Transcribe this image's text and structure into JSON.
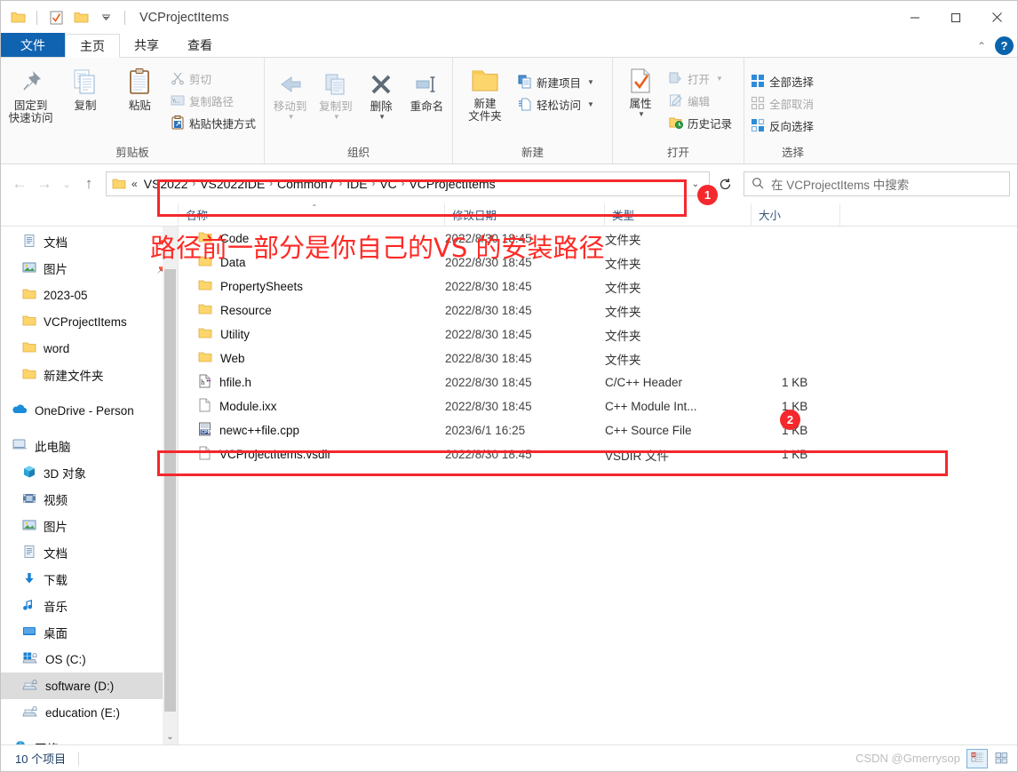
{
  "window": {
    "title": "VCProjectItems",
    "minimize_label": "—",
    "maximize_label": "□",
    "close_label": "✕"
  },
  "quick_access": {
    "folder_icon": "folder-icon",
    "properties_icon": "checkbox-properties-icon",
    "new_folder_icon": "new-folder-icon",
    "dropdown_icon": "chevron-down-icon"
  },
  "tabs": [
    {
      "label": "文件",
      "name": "tab-file"
    },
    {
      "label": "主页",
      "name": "tab-home"
    },
    {
      "label": "共享",
      "name": "tab-share"
    },
    {
      "label": "查看",
      "name": "tab-view"
    }
  ],
  "ribbon": {
    "collapse_icon": "chevron-up-icon",
    "help_label": "?",
    "groups": [
      {
        "label": "剪贴板",
        "big": [
          {
            "label": "固定到\n快速访问",
            "line1": "固定到",
            "line2": "快速访问",
            "icon": "pin-icon"
          },
          {
            "label": "复制",
            "icon": "copy-icon"
          },
          {
            "label": "粘贴",
            "icon": "paste-icon"
          }
        ],
        "small": [
          {
            "label": "剪切",
            "icon": "scissors-icon",
            "disabled": true
          },
          {
            "label": "复制路径",
            "icon": "copy-path-icon",
            "disabled": true
          },
          {
            "label": "粘贴快捷方式",
            "icon": "paste-shortcut-icon",
            "disabled": false
          }
        ]
      },
      {
        "label": "组织",
        "big": [
          {
            "label": "移动到",
            "icon": "move-to-icon",
            "caret": true,
            "disabled": true
          },
          {
            "label": "复制到",
            "icon": "copy-to-icon",
            "caret": true,
            "disabled": true
          },
          {
            "label": "删除",
            "icon": "delete-x-icon",
            "caret": true
          },
          {
            "label": "重命名",
            "icon": "rename-icon"
          }
        ]
      },
      {
        "label": "新建",
        "big": [
          {
            "line1": "新建",
            "line2": "文件夹",
            "icon": "new-folder-icon"
          }
        ],
        "small": [
          {
            "label": "新建项目",
            "icon": "new-item-icon",
            "caret": true
          },
          {
            "label": "轻松访问",
            "icon": "easy-access-icon",
            "caret": true
          }
        ]
      },
      {
        "label": "打开",
        "big": [
          {
            "label": "属性",
            "icon": "properties-icon",
            "caret": true
          }
        ],
        "small": [
          {
            "label": "打开",
            "icon": "open-icon",
            "caret": true,
            "disabled": true
          },
          {
            "label": "编辑",
            "icon": "edit-icon",
            "disabled": true
          },
          {
            "label": "历史记录",
            "icon": "history-icon"
          }
        ]
      },
      {
        "label": "选择",
        "small": [
          {
            "label": "全部选择",
            "icon": "select-all-icon"
          },
          {
            "label": "全部取消",
            "icon": "select-none-icon",
            "disabled": true
          },
          {
            "label": "反向选择",
            "icon": "invert-selection-icon"
          }
        ]
      }
    ]
  },
  "address": {
    "back_icon": "arrow-left-icon",
    "forward_icon": "arrow-right-icon",
    "recent_icon": "chevron-down-icon",
    "up_icon": "arrow-up-icon",
    "folder_icon": "folder-icon",
    "overflow": "«",
    "crumbs": [
      "VS2022",
      "VS2022IDE",
      "Common7",
      "IDE",
      "VC",
      "VCProjectItems"
    ],
    "separator": "›",
    "dropdown_icon": "chevron-down-icon",
    "refresh_icon": "refresh-icon",
    "search_icon": "search-icon",
    "search_placeholder": "在 VCProjectItems 中搜索"
  },
  "columns": [
    {
      "label": "名称",
      "name": "column-name"
    },
    {
      "label": "修改日期",
      "name": "column-date"
    },
    {
      "label": "类型",
      "name": "column-type"
    },
    {
      "label": "大小",
      "name": "column-size"
    }
  ],
  "sidebar": {
    "items": [
      {
        "label": "文档",
        "icon": "documents-icon",
        "pinned": true,
        "level": 1
      },
      {
        "label": "图片",
        "icon": "pictures-icon",
        "pinned": true,
        "level": 1
      },
      {
        "label": "2023-05",
        "icon": "folder-icon",
        "level": 1
      },
      {
        "label": "VCProjectItems",
        "icon": "folder-icon",
        "level": 1
      },
      {
        "label": "word",
        "icon": "folder-icon",
        "level": 1
      },
      {
        "label": "新建文件夹",
        "icon": "folder-icon",
        "level": 1
      },
      {
        "label": "OneDrive - Person",
        "icon": "onedrive-icon",
        "level": 0,
        "gap_before": true
      },
      {
        "label": "此电脑",
        "icon": "this-pc-icon",
        "level": 0,
        "gap_before": true
      },
      {
        "label": "3D 对象",
        "icon": "3d-objects-icon",
        "level": 1
      },
      {
        "label": "视频",
        "icon": "videos-icon",
        "level": 1
      },
      {
        "label": "图片",
        "icon": "pictures-icon",
        "level": 1
      },
      {
        "label": "文档",
        "icon": "documents-icon",
        "level": 1
      },
      {
        "label": "下载",
        "icon": "downloads-icon",
        "level": 1
      },
      {
        "label": "音乐",
        "icon": "music-icon",
        "level": 1
      },
      {
        "label": "桌面",
        "icon": "desktop-icon",
        "level": 1
      },
      {
        "label": "OS (C:)",
        "icon": "windows-drive-icon",
        "level": 1
      },
      {
        "label": "software (D:)",
        "icon": "drive-icon",
        "level": 1,
        "selected": true
      },
      {
        "label": "education (E:)",
        "icon": "drive-icon",
        "level": 1
      },
      {
        "label": "网络",
        "icon": "network-icon",
        "level": 0,
        "gap_before": true
      }
    ],
    "scroll_down_icon": "chevron-down-icon"
  },
  "files": [
    {
      "name": "Code",
      "date": "2022/8/30 18:45",
      "type": "文件夹",
      "size": "",
      "icon": "folder-icon"
    },
    {
      "name": "Data",
      "date": "2022/8/30 18:45",
      "type": "文件夹",
      "size": "",
      "icon": "folder-icon"
    },
    {
      "name": "PropertySheets",
      "date": "2022/8/30 18:45",
      "type": "文件夹",
      "size": "",
      "icon": "folder-icon"
    },
    {
      "name": "Resource",
      "date": "2022/8/30 18:45",
      "type": "文件夹",
      "size": "",
      "icon": "folder-icon"
    },
    {
      "name": "Utility",
      "date": "2022/8/30 18:45",
      "type": "文件夹",
      "size": "",
      "icon": "folder-icon"
    },
    {
      "name": "Web",
      "date": "2022/8/30 18:45",
      "type": "文件夹",
      "size": "",
      "icon": "folder-icon"
    },
    {
      "name": "hfile.h",
      "date": "2022/8/30 18:45",
      "type": "C/C++ Header",
      "size": "1 KB",
      "icon": "h-file-icon"
    },
    {
      "name": "Module.ixx",
      "date": "2022/8/30 18:45",
      "type": "C++ Module Int...",
      "size": "1 KB",
      "icon": "blank-file-icon"
    },
    {
      "name": "newc++file.cpp",
      "date": "2023/6/1 16:25",
      "type": "C++ Source File",
      "size": "1 KB",
      "icon": "cpp-file-icon"
    },
    {
      "name": "VCProjectItems.vsdir",
      "date": "2022/8/30 18:45",
      "type": "VSDIR 文件",
      "size": "1 KB",
      "icon": "blank-file-icon"
    }
  ],
  "status": {
    "item_count": "10 个项目",
    "watermark": "CSDN @Gmerrysop",
    "details_view_icon": "details-view-icon",
    "large_icons_view_icon": "large-icons-view-icon"
  },
  "annotations": {
    "badge1": "1",
    "badge2": "2",
    "note_text": "路径前一部分是你自己的VS 的安装路径",
    "highlight_color": "#f4282d"
  }
}
